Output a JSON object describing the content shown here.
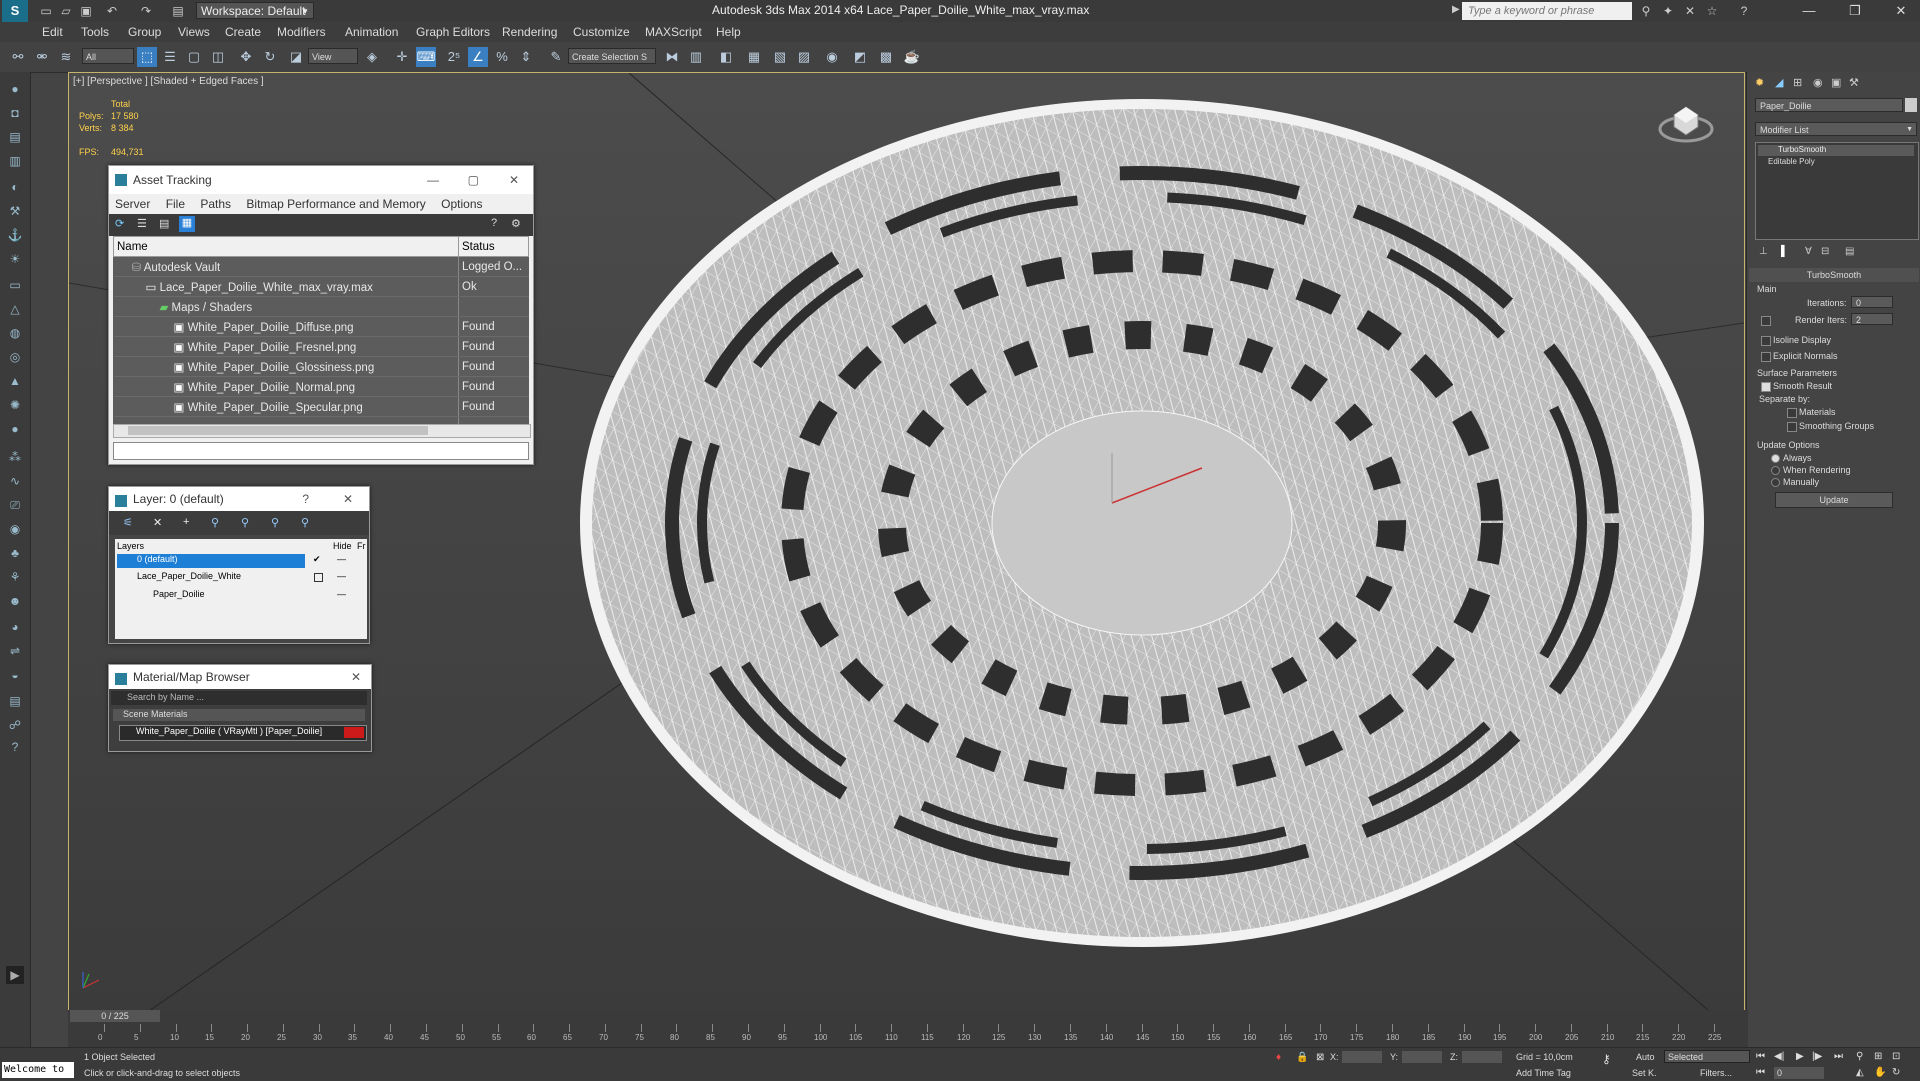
{
  "titlebar": {
    "workspace": "Workspace: Default",
    "title": "Autodesk 3ds Max  2014 x64      Lace_Paper_Doilie_White_max_vray.max",
    "search_placeholder": "Type a keyword or phrase"
  },
  "menu": [
    "Edit",
    "Tools",
    "Group",
    "Views",
    "Create",
    "Modifiers",
    "Animation",
    "Graph Editors",
    "Rendering",
    "Customize",
    "MAXScript",
    "Help"
  ],
  "toolbar": {
    "selection_filter": "All",
    "ref_coord": "View",
    "named_selection": "Create Selection S"
  },
  "viewport": {
    "label": "[+] [Perspective ] [Shaded + Edged Faces ]",
    "stats": {
      "total_label": "Total",
      "polys_label": "Polys:",
      "polys": "17 580",
      "verts_label": "Verts:",
      "verts": "8 384",
      "fps_label": "FPS:",
      "fps": "494,731"
    }
  },
  "asset_tracking": {
    "title": "Asset Tracking",
    "menus": [
      "Server",
      "File",
      "Paths",
      "Bitmap Performance and Memory",
      "Options"
    ],
    "columns": [
      "Name",
      "Status"
    ],
    "rows": [
      {
        "name": "Autodesk Vault",
        "status": "Logged O..."
      },
      {
        "name": "Lace_Paper_Doilie_White_max_vray.max",
        "status": "Ok"
      },
      {
        "name": "Maps / Shaders",
        "status": ""
      },
      {
        "name": "White_Paper_Doilie_Diffuse.png",
        "status": "Found"
      },
      {
        "name": "White_Paper_Doilie_Fresnel.png",
        "status": "Found"
      },
      {
        "name": "White_Paper_Doilie_Glossiness.png",
        "status": "Found"
      },
      {
        "name": "White_Paper_Doilie_Normal.png",
        "status": "Found"
      },
      {
        "name": "White_Paper_Doilie_Specular.png",
        "status": "Found"
      }
    ]
  },
  "layer_window": {
    "title": "Layer: 0 (default)",
    "help": "?",
    "columns": [
      "Layers",
      "Hide",
      "Fr"
    ],
    "layers": [
      "0 (default)",
      "Lace_Paper_Doilie_White",
      "Paper_Doilie"
    ]
  },
  "material_browser": {
    "title": "Material/Map Browser",
    "search_placeholder": "Search by Name ...",
    "section": "Scene Materials",
    "item": "White_Paper_Doilie  ( VRayMtl ) [Paper_Doilie]"
  },
  "command_panel": {
    "object_name": "Paper_Doilie",
    "modifier_list": "Modifier List",
    "stack": [
      "TurboSmooth",
      "Editable Poly"
    ],
    "rollout_title": "TurboSmooth",
    "main_label": "Main",
    "iterations_label": "Iterations:",
    "iterations": "0",
    "render_iters_label": "Render Iters:",
    "render_iters": "2",
    "isoline_display": "Isoline Display",
    "explicit_normals": "Explicit Normals",
    "surface_params": "Surface Parameters",
    "smooth_result": "Smooth Result",
    "separate_by": "Separate by:",
    "materials": "Materials",
    "smoothing_groups": "Smoothing Groups",
    "update_options": "Update Options",
    "always": "Always",
    "when_rendering": "When Rendering",
    "manually": "Manually",
    "update_button": "Update"
  },
  "timeline": {
    "frame_counter": "0 / 225",
    "ticks": [
      "0",
      "5",
      "10",
      "15",
      "20",
      "25",
      "30",
      "35",
      "40",
      "45",
      "50",
      "55",
      "60",
      "65",
      "70",
      "75",
      "80",
      "85",
      "90",
      "95",
      "100",
      "105",
      "110",
      "115",
      "120",
      "125",
      "130",
      "135",
      "140",
      "145",
      "150",
      "155",
      "160",
      "165",
      "170",
      "175",
      "180",
      "185",
      "190",
      "195",
      "200",
      "205",
      "210",
      "215",
      "220",
      "225"
    ]
  },
  "status": {
    "maxscript": "Welcome to",
    "selection": "1 Object Selected",
    "prompt": "Click or click-and-drag to select objects",
    "x_label": "X:",
    "y_label": "Y:",
    "z_label": "Z:",
    "grid": "Grid = 10,0cm",
    "add_time_tag": "Add Time Tag",
    "auto": "Auto",
    "set_key": "Set K.",
    "key_mode": "Selected",
    "filters": "Filters...",
    "frame": "0"
  },
  "colors": {
    "accent": "#1e7fd6",
    "viewport_border": "#c9b26a",
    "stats": "#ffd24a",
    "material_swatch": "#cc1a1a"
  }
}
